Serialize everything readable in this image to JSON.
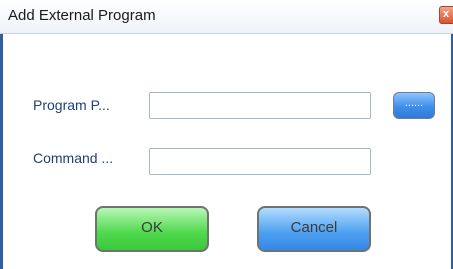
{
  "window": {
    "title": "Add External Program",
    "close_glyph": "x"
  },
  "form": {
    "program_path_label": "Program P...",
    "program_path_value": "",
    "command_label": "Command ...",
    "command_value": "",
    "browse_label": "......"
  },
  "buttons": {
    "ok_label": "OK",
    "cancel_label": "Cancel"
  },
  "colors": {
    "label_text": "#1e3f78",
    "ok_button": "#4fd84c",
    "cancel_button": "#4c9ff0",
    "window_frame": "#2f5fa0"
  }
}
